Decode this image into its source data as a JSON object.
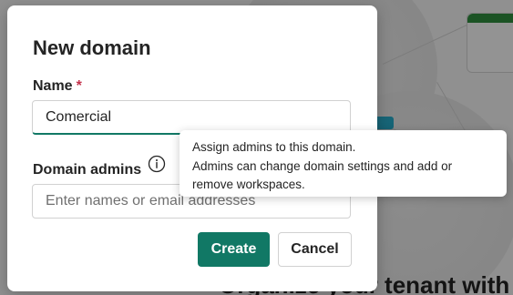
{
  "dialog": {
    "title": "New domain",
    "name_label": "Name",
    "required_marker": "*",
    "name_value": "Comercial",
    "admins_label": "Domain admins",
    "admins_placeholder": "Enter names or email addresses",
    "create_label": "Create",
    "cancel_label": "Cancel"
  },
  "tooltip": {
    "line1": "Assign admins to this domain.",
    "line2": "Admins can change domain settings and add or",
    "line3": "remove workspaces."
  },
  "background": {
    "heading": "Organize your tenant with domains"
  },
  "icons": {
    "info": "info-icon"
  },
  "colors": {
    "primary": "#117865",
    "required": "#c4314b"
  }
}
